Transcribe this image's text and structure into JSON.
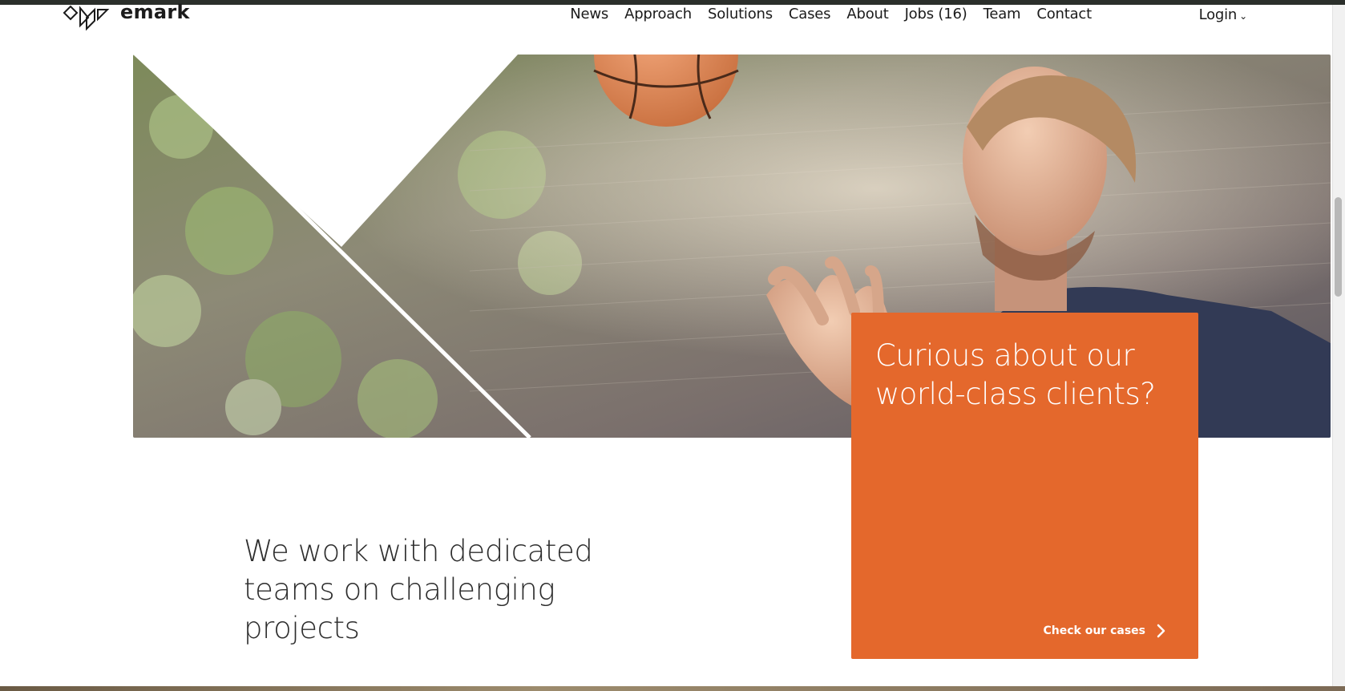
{
  "brand": {
    "name": "emark",
    "accent_color": "#e4682c"
  },
  "nav": {
    "items": [
      {
        "label": "News"
      },
      {
        "label": "Approach"
      },
      {
        "label": "Solutions"
      },
      {
        "label": "Cases"
      },
      {
        "label": "About"
      },
      {
        "label": "Jobs (16)"
      },
      {
        "label": "Team"
      },
      {
        "label": "Contact"
      }
    ],
    "login_label": "Login",
    "login_icon": "chevron-down-icon"
  },
  "hero": {
    "image_subject": "man-spinning-basketball-outdoors"
  },
  "card": {
    "title": "Curious about our world-class clients?",
    "link_label": "Check our cases",
    "link_icon": "chevron-right-icon"
  },
  "tagline": "We work with dedicated teams on challenging projects"
}
